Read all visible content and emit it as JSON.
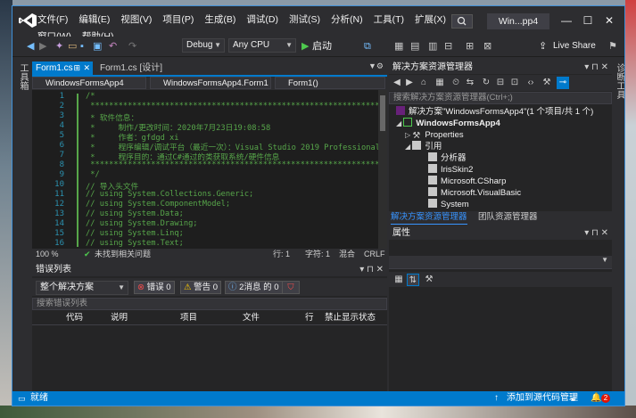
{
  "window": {
    "title": "Win...pp4",
    "menu": [
      "文件(F)",
      "编辑(E)",
      "视图(V)",
      "项目(P)",
      "生成(B)",
      "调试(D)",
      "测试(S)",
      "分析(N)",
      "工具(T)",
      "扩展(X)",
      "窗口(W)",
      "帮助(H)"
    ],
    "minimize": "—",
    "maximize": "☐",
    "close": "✕"
  },
  "toolbar": {
    "config": "Debug",
    "platform": "Any CPU",
    "start_label": "启动",
    "live_share": "Live Share"
  },
  "left_strip": {
    "label": "工具箱"
  },
  "right_strip": {
    "label": "诊断工具"
  },
  "editor": {
    "tabs": [
      {
        "label": "Form1.cs",
        "close": "✕",
        "pin": "⊞",
        "active": true
      },
      {
        "label": "Form1.cs [设计]",
        "active": false
      }
    ],
    "nav": [
      "WindowsFormsApp4",
      "WindowsFormsApp4.Form1",
      "Form1()"
    ],
    "line_numbers": [
      "1",
      "2",
      "3",
      "4",
      "5",
      "6",
      "7",
      "8",
      "9",
      "10",
      "11",
      "12",
      "13",
      "14",
      "15",
      "16"
    ],
    "code_lines": [
      "/*",
      " ***********************************************************************",
      " * 软件信息：",
      " *     制作/更改时间：2020年7月23日19:08:58",
      " *     作者：gfdgd xi",
      " *     程序编辑/调试平台（最近一次）：Visual Studio 2019 Professional",
      " *     程序目的：通过C#通过的类获取系统/硬件信息",
      " ***********************************************************************",
      " */",
      "// 导入头文件",
      "// using System.Collections.Generic;",
      "// using System.ComponentModel;",
      "// using System.Data;",
      "// using System.Drawing;",
      "// using System.Linq;",
      "// using System.Text;"
    ],
    "status": {
      "zoom": "100 %",
      "issues": "未找到相关问题",
      "line": "行: 1",
      "col": "字符: 1",
      "mode": "混合",
      "eol": "CRLF"
    }
  },
  "error_list": {
    "title": "错误列表",
    "scope": "整个解决方案",
    "errors": "错误 0",
    "warnings": "警告 0",
    "messages": "2消息 的 0",
    "search_placeholder": "搜索错误列表",
    "columns": [
      "代码",
      "说明",
      "项目",
      "文件",
      "行",
      "禁止显示状态"
    ]
  },
  "solution_explorer": {
    "title": "解决方案资源管理器",
    "search_placeholder": "搜索解决方案资源管理器(Ctrl+;)",
    "tree": [
      {
        "label": "解决方案\"WindowsFormsApp4\"(1 个项目/共 1 个)",
        "indent": 0,
        "bold": false
      },
      {
        "label": "WindowsFormsApp4",
        "indent": 1,
        "bold": true
      },
      {
        "label": "Properties",
        "indent": 2,
        "bold": false
      },
      {
        "label": "引用",
        "indent": 2,
        "bold": false
      },
      {
        "label": "分析器",
        "indent": 3,
        "bold": false
      },
      {
        "label": "IrisSkin2",
        "indent": 3,
        "bold": false
      },
      {
        "label": "Microsoft.CSharp",
        "indent": 3,
        "bold": false
      },
      {
        "label": "Microsoft.VisualBasic",
        "indent": 3,
        "bold": false
      },
      {
        "label": "System",
        "indent": 3,
        "bold": false
      }
    ],
    "tabs": [
      "解决方案资源管理器",
      "团队资源管理器"
    ]
  },
  "properties": {
    "title": "属性"
  },
  "statusbar": {
    "ready": "就绪",
    "source_control": "添加到源代码管理",
    "notifications": "2"
  },
  "colors": {
    "accent": "#007acc",
    "editor_bg": "#1e1e1e",
    "chrome": "#2d2d30",
    "comment": "#57a64a",
    "line_number": "#2b91af"
  }
}
